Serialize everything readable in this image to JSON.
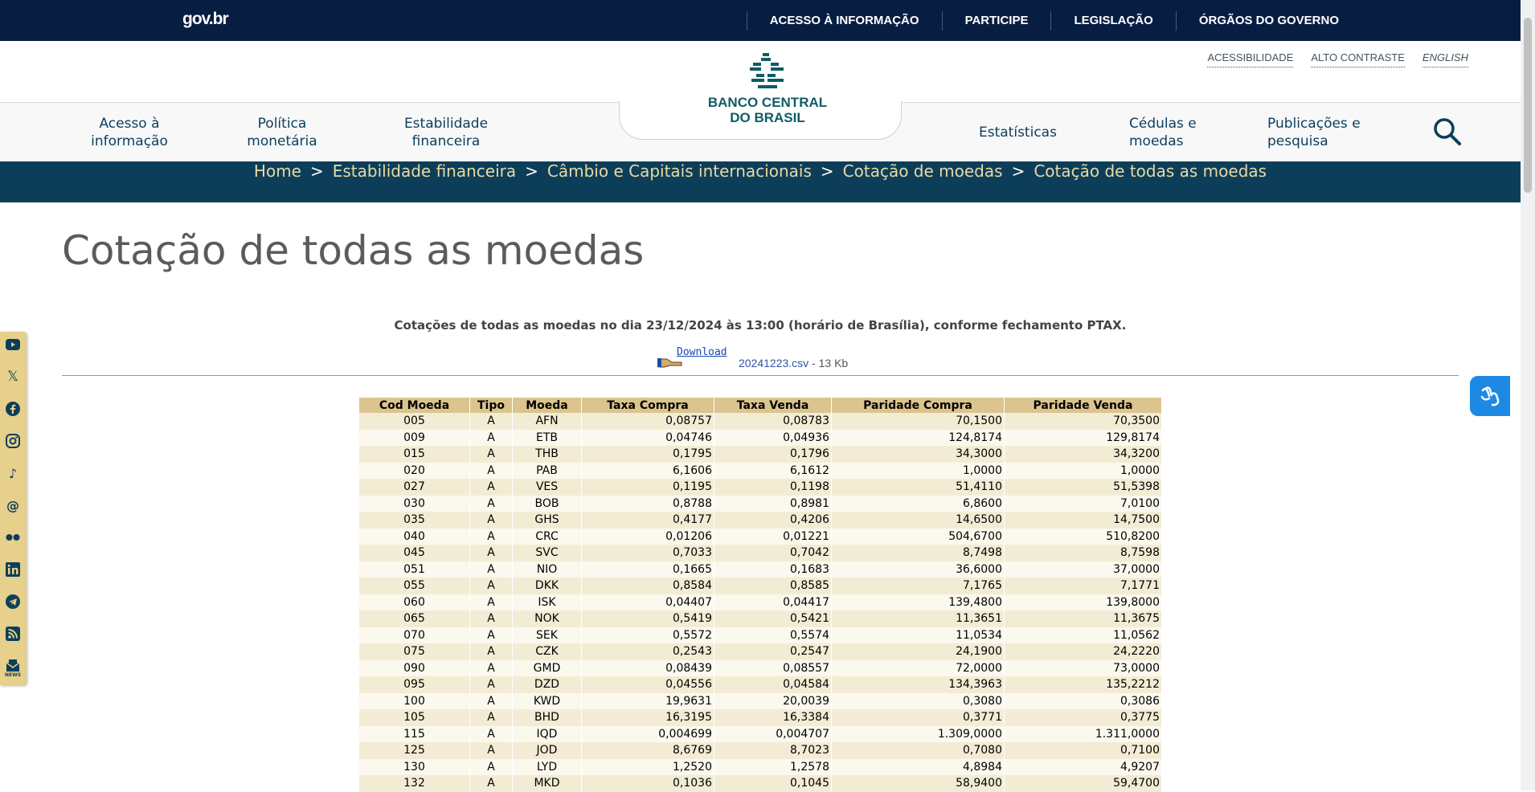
{
  "gov": {
    "logo": "gov.br",
    "links": [
      "ACESSO À INFORMAÇÃO",
      "PARTICIPE",
      "LEGISLAÇÃO",
      "ÓRGÃOS DO GOVERNO"
    ]
  },
  "utility": {
    "accessibility": "ACESSIBILIDADE",
    "contrast": "ALTO CONTRASTE",
    "english": "ENGLISH"
  },
  "brand": {
    "line1": "BANCO CENTRAL",
    "line2": "DO BRASIL"
  },
  "nav": [
    {
      "l1": "Acesso à",
      "l2": "informação"
    },
    {
      "l1": "Política",
      "l2": "monetária"
    },
    {
      "l1": "Estabilidade",
      "l2": "financeira"
    },
    {
      "l1": "Estatísticas",
      "l2": ""
    },
    {
      "l1": "Cédulas e",
      "l2": "moedas"
    },
    {
      "l1": "Publicações e",
      "l2": "pesquisa"
    }
  ],
  "breadcrumb": [
    "Home",
    "Estabilidade financeira",
    "Câmbio e Capitais internacionais",
    "Cotação de moedas",
    "Cotação de todas as moedas"
  ],
  "title": "Cotação de todas as moedas",
  "subtitle": "Cotações de todas as moedas no dia 23/12/2024 às 13:00 (horário de Brasília), conforme fechamento PTAX.",
  "download": {
    "label": "Download",
    "file": "20241223.csv",
    "size": " - 13 Kb"
  },
  "table": {
    "headers": [
      "Cod Moeda",
      "Tipo",
      "Moeda",
      "Taxa Compra",
      "Taxa Venda",
      "Paridade Compra",
      "Paridade Venda"
    ],
    "rows": [
      [
        "005",
        "A",
        "AFN",
        "0,08757",
        "0,08783",
        "70,1500",
        "70,3500"
      ],
      [
        "009",
        "A",
        "ETB",
        "0,04746",
        "0,04936",
        "124,8174",
        "129,8174"
      ],
      [
        "015",
        "A",
        "THB",
        "0,1795",
        "0,1796",
        "34,3000",
        "34,3200"
      ],
      [
        "020",
        "A",
        "PAB",
        "6,1606",
        "6,1612",
        "1,0000",
        "1,0000"
      ],
      [
        "027",
        "A",
        "VES",
        "0,1195",
        "0,1198",
        "51,4110",
        "51,5398"
      ],
      [
        "030",
        "A",
        "BOB",
        "0,8788",
        "0,8981",
        "6,8600",
        "7,0100"
      ],
      [
        "035",
        "A",
        "GHS",
        "0,4177",
        "0,4206",
        "14,6500",
        "14,7500"
      ],
      [
        "040",
        "A",
        "CRC",
        "0,01206",
        "0,01221",
        "504,6700",
        "510,8200"
      ],
      [
        "045",
        "A",
        "SVC",
        "0,7033",
        "0,7042",
        "8,7498",
        "8,7598"
      ],
      [
        "051",
        "A",
        "NIO",
        "0,1665",
        "0,1683",
        "36,6000",
        "37,0000"
      ],
      [
        "055",
        "A",
        "DKK",
        "0,8584",
        "0,8585",
        "7,1765",
        "7,1771"
      ],
      [
        "060",
        "A",
        "ISK",
        "0,04407",
        "0,04417",
        "139,4800",
        "139,8000"
      ],
      [
        "065",
        "A",
        "NOK",
        "0,5419",
        "0,5421",
        "11,3651",
        "11,3675"
      ],
      [
        "070",
        "A",
        "SEK",
        "0,5572",
        "0,5574",
        "11,0534",
        "11,0562"
      ],
      [
        "075",
        "A",
        "CZK",
        "0,2543",
        "0,2547",
        "24,1900",
        "24,2220"
      ],
      [
        "090",
        "A",
        "GMD",
        "0,08439",
        "0,08557",
        "72,0000",
        "73,0000"
      ],
      [
        "095",
        "A",
        "DZD",
        "0,04556",
        "0,04584",
        "134,3963",
        "135,2212"
      ],
      [
        "100",
        "A",
        "KWD",
        "19,9631",
        "20,0039",
        "0,3080",
        "0,3086"
      ],
      [
        "105",
        "A",
        "BHD",
        "16,3195",
        "16,3384",
        "0,3771",
        "0,3775"
      ],
      [
        "115",
        "A",
        "IQD",
        "0,004699",
        "0,004707",
        "1.309,0000",
        "1.311,0000"
      ],
      [
        "125",
        "A",
        "JOD",
        "8,6769",
        "8,7023",
        "0,7080",
        "0,7100"
      ],
      [
        "130",
        "A",
        "LYD",
        "1,2520",
        "1,2578",
        "4,8984",
        "4,9207"
      ],
      [
        "132",
        "A",
        "MKD",
        "0,1036",
        "0,1045",
        "58,9400",
        "59,4700"
      ]
    ]
  },
  "social": [
    "youtube-icon",
    "x-icon",
    "facebook-icon",
    "instagram-icon",
    "tiktok-icon",
    "threads-icon",
    "flickr-icon",
    "linkedin-icon",
    "telegram-icon",
    "rss-icon",
    "news-icon"
  ],
  "social_news_label": "NEWS",
  "colors": {
    "govbar": "#071d41",
    "breadcrumb_bg": "#0d3e59",
    "table_header": "#dcc48e"
  }
}
